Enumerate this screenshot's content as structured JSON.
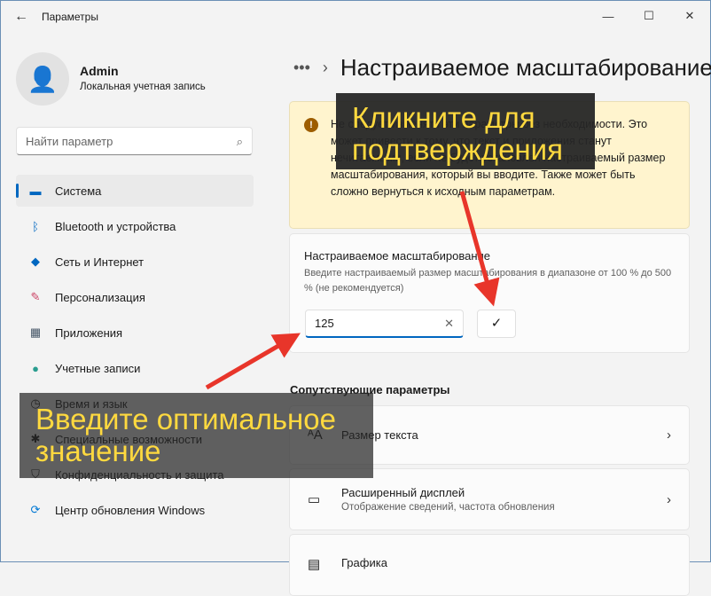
{
  "window": {
    "title": "Параметры"
  },
  "user": {
    "name": "Admin",
    "subtitle": "Локальная учетная запись"
  },
  "search": {
    "placeholder": "Найти параметр"
  },
  "nav": [
    {
      "label": "Система",
      "icon": "monitor-icon",
      "active": true
    },
    {
      "label": "Bluetooth и устройства",
      "icon": "bluetooth-icon"
    },
    {
      "label": "Сеть и Интернет",
      "icon": "wifi-icon"
    },
    {
      "label": "Персонализация",
      "icon": "brush-icon"
    },
    {
      "label": "Приложения",
      "icon": "apps-icon"
    },
    {
      "label": "Учетные записи",
      "icon": "person-icon"
    },
    {
      "label": "Время и язык",
      "icon": "clock-icon"
    },
    {
      "label": "Специальные возможности",
      "icon": "accessibility-icon"
    },
    {
      "label": "Конфиденциальность и защита",
      "icon": "shield-icon"
    },
    {
      "label": "Центр обновления Windows",
      "icon": "update-icon"
    }
  ],
  "breadcrumb": {
    "title": "Настраиваемое масштабирование"
  },
  "warning": {
    "text": "Не следует изменять эти параметры без необходимости. Это может привести к тому, что текст и приложения станут нечитаемыми, если не будет установлен настраиваемый размер масштабирования, который вы вводите. Также может быть сложно вернуться к исходным параметрам."
  },
  "scaling": {
    "title": "Настраиваемое масштабирование",
    "description": "Введите настраиваемый размер масштабирования в диапазоне от 100 % до 500 % (не рекомендуется)",
    "value": "125"
  },
  "related": {
    "heading": "Сопутствующие параметры",
    "items": [
      {
        "title": "Размер текста",
        "subtitle": ""
      },
      {
        "title": "Расширенный дисплей",
        "subtitle": "Отображение сведений, частота обновления"
      },
      {
        "title": "Графика",
        "subtitle": ""
      }
    ]
  },
  "annotations": {
    "confirm": "Кликните для подтверждения",
    "enter": "Введите оптимальное значение"
  }
}
